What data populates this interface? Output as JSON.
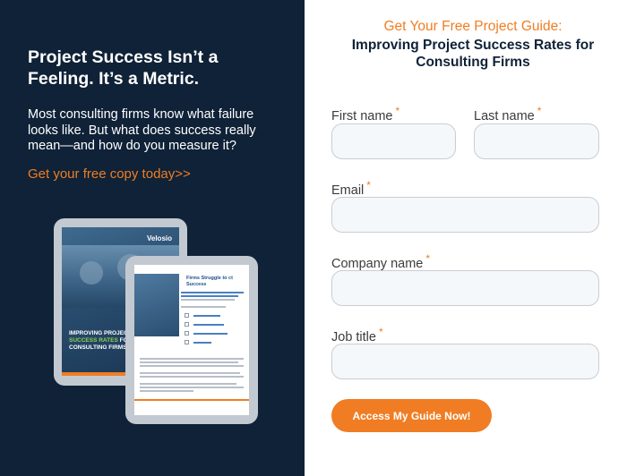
{
  "promo": {
    "headline": "Project Success Isn’t a Feeling. It’s a Metric.",
    "body": "Most consulting firms know what failure looks like. But what does success really mean—and how do you measure it?",
    "cta_link": "Get your free copy today>>",
    "ebook_cover": {
      "logo": "Velosio",
      "title_line1": "IMPROVING PROJECT",
      "title_highlight": "SUCCESS RATES",
      "title_line2_rest": "FOR",
      "title_line3": "CONSULTING FIRMS"
    },
    "ebook_page": {
      "heading": "Firms Struggle to ct Success"
    }
  },
  "form": {
    "subtitle": "Get Your Free Project Guide:",
    "title": "Improving Project Success Rates for Consulting Firms",
    "required_marker": "*",
    "fields": {
      "first_name": {
        "label": "First name",
        "value": "",
        "placeholder": ""
      },
      "last_name": {
        "label": "Last name",
        "value": "",
        "placeholder": ""
      },
      "email": {
        "label": "Email",
        "value": "",
        "placeholder": ""
      },
      "company_name": {
        "label": "Company name",
        "value": "",
        "placeholder": ""
      },
      "job_title": {
        "label": "Job title",
        "value": "",
        "placeholder": ""
      }
    },
    "submit_label": "Access My Guide Now!"
  },
  "colors": {
    "navy": "#0f2237",
    "accent_orange": "#f07d23",
    "input_bg": "#f5f8fa",
    "cover_highlight_green": "#8fd14f"
  }
}
